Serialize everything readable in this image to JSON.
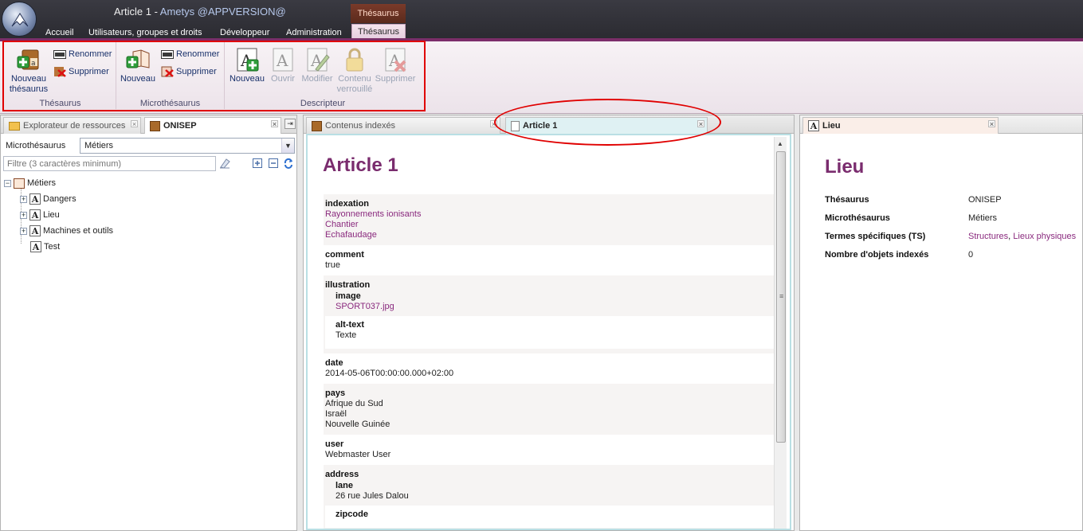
{
  "window": {
    "doc_title": "Article 1 - ",
    "app_name": "Ametys @APPVERSION@",
    "context_tab": "Thésaurus"
  },
  "menu": {
    "tabs": [
      "Accueil",
      "Utilisateurs, groupes et droits",
      "Développeur",
      "Administration",
      "Thésaurus"
    ]
  },
  "ribbon": {
    "thesaurus": {
      "label": "Thésaurus",
      "new_line1": "Nouveau",
      "new_line2": "thésaurus",
      "rename": "Renommer",
      "delete": "Supprimer"
    },
    "microthesaurus": {
      "label": "Microthésaurus",
      "new": "Nouveau",
      "rename": "Renommer",
      "delete": "Supprimer"
    },
    "descripteur": {
      "label": "Descripteur",
      "new": "Nouveau",
      "open": "Ouvrir",
      "modify": "Modifier",
      "locked_line1": "Contenu",
      "locked_line2": "verrouillé",
      "delete": "Supprimer"
    }
  },
  "left_panel": {
    "tab_explorer": "Explorateur de ressources",
    "tab_onisep": "ONISEP",
    "micro_label": "Microthésaurus",
    "micro_value": "Métiers",
    "filter_placeholder": "Filtre (3 caractères minimum)",
    "tree_root": "Métiers",
    "tree_items": [
      "Dangers",
      "Lieu",
      "Machines et outils",
      "Test"
    ]
  },
  "middle_panel": {
    "tab_indexed": "Contenus indexés",
    "tab_article": "Article 1",
    "title": "Article 1",
    "fields": {
      "indexation": {
        "name": "indexation",
        "values": [
          "Rayonnements ionisants",
          "Chantier",
          "Echafaudage"
        ]
      },
      "comment": {
        "name": "comment",
        "value": "true"
      },
      "illustration": {
        "name": "illustration",
        "image_name": "image",
        "image_value": "SPORT037.jpg",
        "alt_name": "alt-text",
        "alt_value": "Texte"
      },
      "date": {
        "name": "date",
        "value": "2014-05-06T00:00:00.000+02:00"
      },
      "pays": {
        "name": "pays",
        "values": [
          "Afrique du Sud",
          "Israël",
          "Nouvelle Guinée"
        ]
      },
      "user": {
        "name": "user",
        "value": "Webmaster User"
      },
      "address": {
        "name": "address",
        "lane_name": "lane",
        "lane_value": "26 rue Jules Dalou",
        "zip_name": "zipcode"
      }
    }
  },
  "right_panel": {
    "tab": "Lieu",
    "title": "Lieu",
    "rows": [
      {
        "key": "Thésaurus",
        "value": "ONISEP"
      },
      {
        "key": "Microthésaurus",
        "value": "Métiers"
      },
      {
        "key": "Termes spécifiques (TS)",
        "link1": "Structures",
        "sep": ", ",
        "link2": "Lieux physiques"
      },
      {
        "key": "Nombre d'objets indexés",
        "value": "0"
      }
    ]
  },
  "colors": {
    "accent": "#7b2e68",
    "title_purple": "#7a2c6e",
    "annotation_red": "#e00000"
  }
}
